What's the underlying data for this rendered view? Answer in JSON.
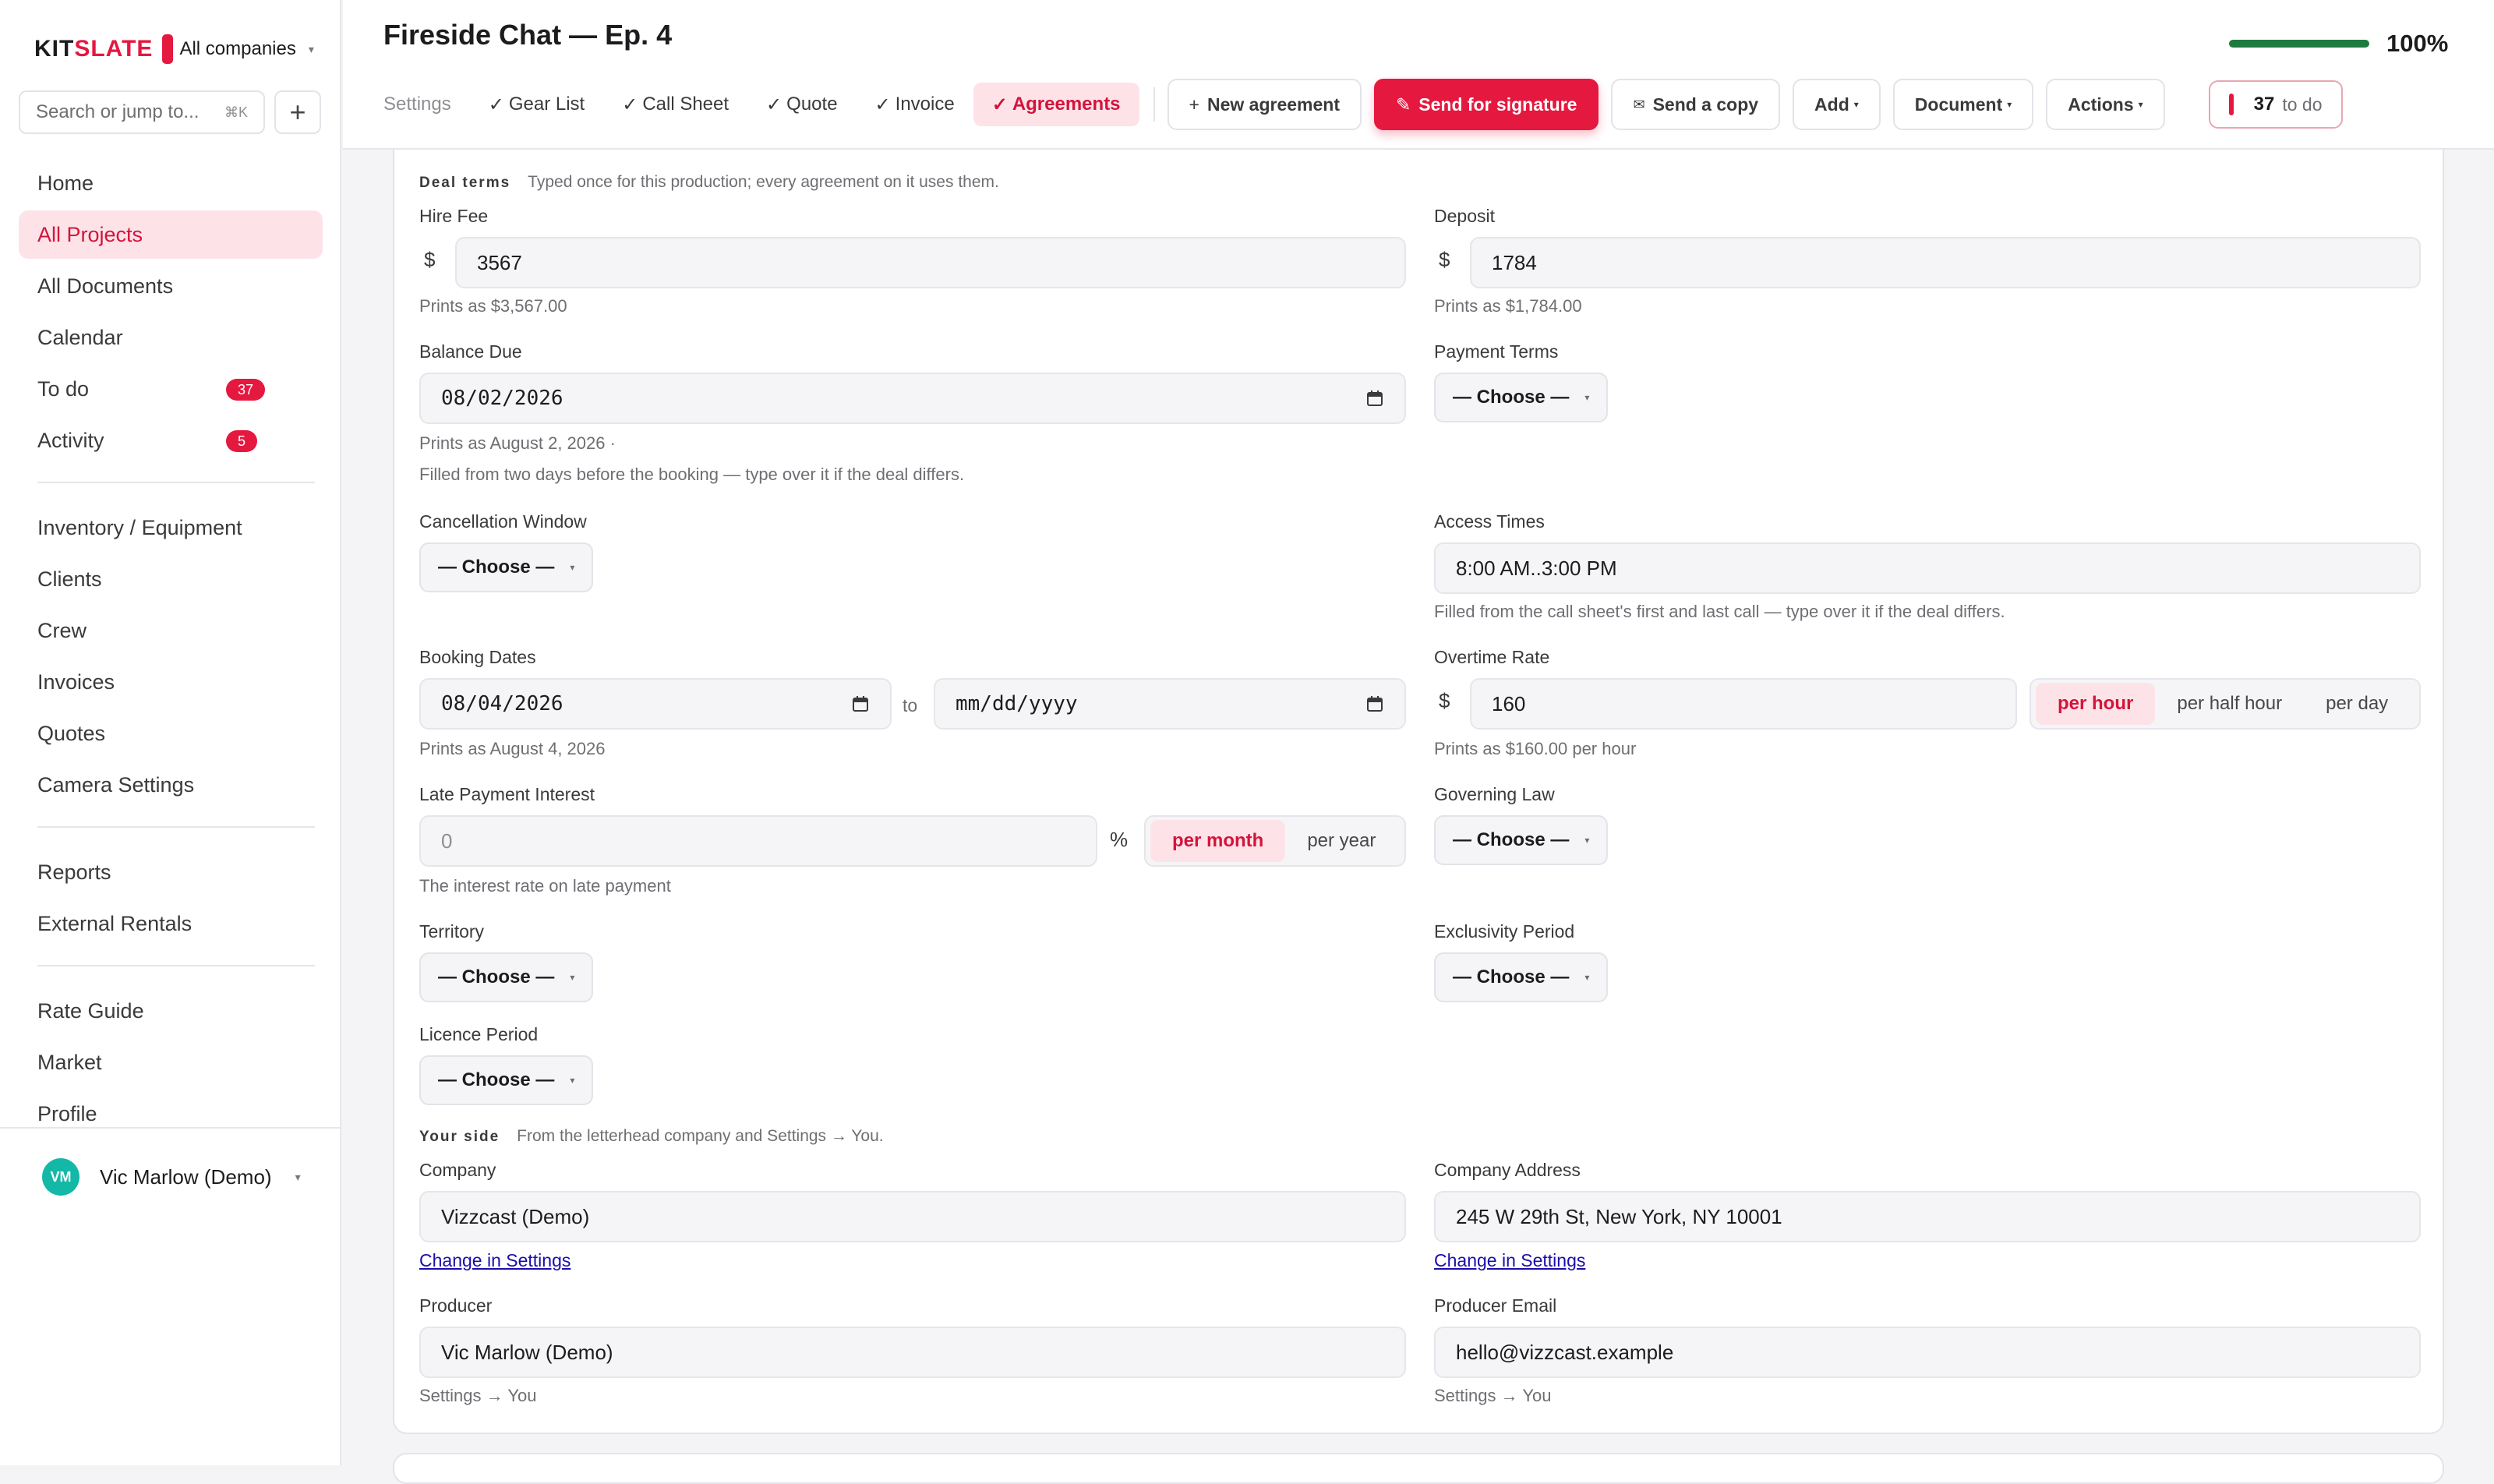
{
  "app": {
    "brand_a": "KIT",
    "brand_b": "SLATE",
    "company_switch": "All companies",
    "search_placeholder": "Search or jump to...",
    "search_shortcut": "⌘K"
  },
  "sidebar": {
    "items": [
      {
        "label": "Home"
      },
      {
        "label": "All Projects"
      },
      {
        "label": "All Documents"
      },
      {
        "label": "Calendar"
      },
      {
        "label": "To do",
        "count": "37"
      },
      {
        "label": "Activity",
        "count": "5"
      },
      {
        "label": "Inventory / Equipment"
      },
      {
        "label": "Clients"
      },
      {
        "label": "Crew"
      },
      {
        "label": "Invoices"
      },
      {
        "label": "Quotes"
      },
      {
        "label": "Camera Settings"
      },
      {
        "label": "Reports"
      },
      {
        "label": "External Rentals"
      },
      {
        "label": "Rate Guide"
      },
      {
        "label": "Market"
      },
      {
        "label": "Profile"
      }
    ],
    "active_index": 1,
    "user": {
      "initials": "VM",
      "name": "Vic Marlow (Demo)"
    }
  },
  "header": {
    "title": "Fireside Chat — Ep. 4",
    "progress_value": 100,
    "progress_label": "100%",
    "tabs": [
      "Settings",
      "Gear List",
      "Call Sheet",
      "Quote",
      "Invoice",
      "Agreements"
    ],
    "checkmark": "✓",
    "buttons": {
      "new_agreement": "New agreement",
      "send_signature": "Send for signature",
      "send_copy": "Send a copy",
      "add": "Add",
      "document": "Document",
      "actions": "Actions"
    },
    "todo_count": "37",
    "todo_label": "to do"
  },
  "deal_terms": {
    "heading": "Deal terms",
    "subheading": "Typed once for this production; every agreement on it uses them.",
    "currency_symbol": "$",
    "hire_fee": {
      "label": "Hire Fee",
      "value": "3567",
      "hint": "Prints as $3,567.00"
    },
    "deposit": {
      "label": "Deposit",
      "value": "1784",
      "hint": "Prints as $1,784.00"
    },
    "balance_due": {
      "label": "Balance Due",
      "value": "08/02/2026",
      "hint1": "Prints as August 2, 2026 ·",
      "hint2": "Filled from two days before the booking — type over it if the deal differs."
    },
    "payment_terms": {
      "label": "Payment Terms",
      "value": "— Choose —"
    },
    "cancellation_window": {
      "label": "Cancellation Window",
      "value": "— Choose —"
    },
    "access_times": {
      "label": "Access Times",
      "value": "8:00 AM..3:00 PM",
      "hint": "Filled from the call sheet's first and last call — type over it if the deal differs."
    },
    "booking_dates": {
      "label": "Booking Dates",
      "start": "08/04/2026",
      "end_placeholder": "mm/dd/yyyy",
      "to": "to",
      "hint": "Prints as August 4, 2026"
    },
    "overtime_rate": {
      "label": "Overtime Rate",
      "value": "160",
      "hint": "Prints as $160.00 per hour",
      "units": [
        "per hour",
        "per half hour",
        "per day"
      ],
      "selected": 0
    },
    "late_payment_interest": {
      "label": "Late Payment Interest",
      "placeholder": "0",
      "symbol": "%",
      "units": [
        "per month",
        "per year"
      ],
      "selected": 0,
      "hint": "The interest rate on late payment"
    },
    "governing_law": {
      "label": "Governing Law",
      "value": "— Choose —"
    },
    "territory": {
      "label": "Territory",
      "value": "— Choose —"
    },
    "exclusivity_period": {
      "label": "Exclusivity Period",
      "value": "— Choose —"
    },
    "licence_period": {
      "label": "Licence Period",
      "value": "— Choose —"
    }
  },
  "your_side": {
    "heading": "Your side",
    "subheading": "From the letterhead company and Settings → You.",
    "company": {
      "label": "Company",
      "value": "Vizzcast (Demo)",
      "link": "Change in Settings"
    },
    "company_address": {
      "label": "Company Address",
      "value": "245 W 29th St, New York, NY 10001",
      "link": "Change in Settings"
    },
    "producer": {
      "label": "Producer",
      "value": "Vic Marlow (Demo)",
      "hint": "Settings → You"
    },
    "producer_email": {
      "label": "Producer Email",
      "value": "hello@vizzcast.example",
      "hint": "Settings → You"
    }
  },
  "colors": {
    "accent": "#e5183f",
    "accent_soft": "#fde3e8",
    "progress": "#1f7a3f"
  }
}
